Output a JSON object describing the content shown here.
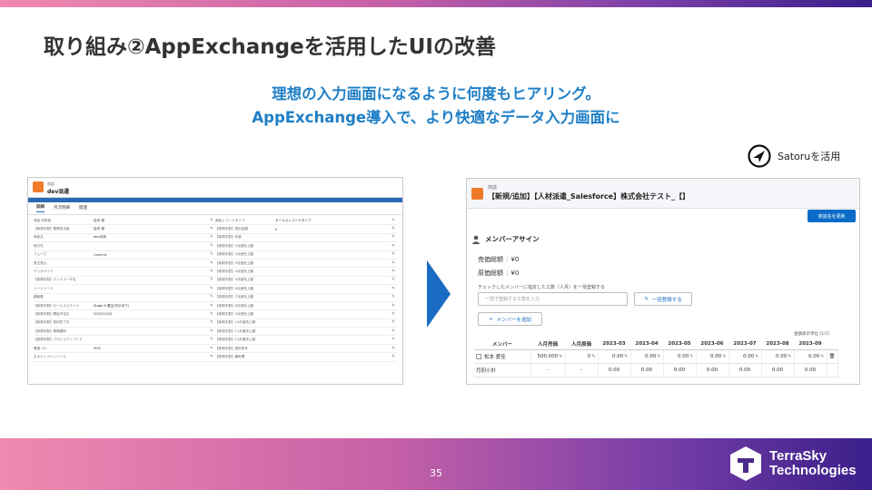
{
  "slide": {
    "title": "取り組み②AppExchangeを活用したUIの改善",
    "subtitle_line1": "理想の入力画面になるように何度もヒアリング。",
    "subtitle_line2": "AppExchange導入で、より快適なデータ入力画面に",
    "satoru_label": "Satoruを活用",
    "page_number": "35",
    "logo_line1": "TerraSky",
    "logo_line2": "Technologies",
    "gradient_colors": [
      "#f08ab0",
      "#c560a8",
      "#7a3fa8",
      "#3a1f8a"
    ],
    "accent_blue": "#1f7fc6",
    "arrow_color": "#1a6bc4"
  },
  "left_screen": {
    "object_label": "商談",
    "record_name": "dev派遣",
    "tabs": [
      "詳細",
      "月次明細",
      "関連"
    ],
    "rows": [
      [
        {
          "label": "商談 所有者",
          "value": "岩本 雅"
        },
        {
          "label": "商談レコードタイプ",
          "value": "セールスレコードタイプ"
        }
      ],
      [
        {
          "label": "【新規手配】業務担当者",
          "value": "岩本 雅"
        },
        {
          "label": "【新規手配】契約金額",
          "value": "0"
        }
      ],
      [
        {
          "label": "商談名",
          "value": "dev派遣"
        },
        {
          "label": "【新規手配】年度",
          "value": ""
        }
      ],
      [
        {
          "label": "取引先",
          "value": ""
        },
        {
          "label": "【新規手配】1月度売上額",
          "value": ""
        }
      ],
      [
        {
          "label": "フェーズ",
          "value": "Commit"
        },
        {
          "label": "【新規手配】2月度売上額",
          "value": ""
        }
      ],
      [
        {
          "label": "受注見込",
          "value": ""
        },
        {
          "label": "【新規手配】3月度売上額",
          "value": ""
        }
      ],
      [
        {
          "label": "デリカバイク",
          "value": ""
        },
        {
          "label": "【新規手配】4月度売上額",
          "value": ""
        }
      ],
      [
        {
          "label": "【新規手配】エンドユーザ名",
          "value": ""
        },
        {
          "label": "【新規手配】5月度売上額",
          "value": ""
        }
      ],
      [
        {
          "label": "リードソース",
          "value": ""
        },
        {
          "label": "【新規手配】6月度売上額",
          "value": ""
        }
      ],
      [
        {
          "label": "顧客層",
          "value": ""
        },
        {
          "label": "【新規手配】7月度売上額",
          "value": ""
        }
      ],
      [
        {
          "label": "【新規手配】セールスステージ",
          "value": "Stage 6 要注(内示あり)"
        },
        {
          "label": "【新規手配】8月度売上額",
          "value": ""
        }
      ],
      [
        {
          "label": "【新規手配】開始予定日",
          "value": "2022/12/01"
        },
        {
          "label": "【新規手配】9月度売上額",
          "value": ""
        }
      ],
      [
        {
          "label": "【新規手配】契約終了日",
          "value": ""
        },
        {
          "label": "【新規手配】10月度売上額",
          "value": ""
        }
      ],
      [
        {
          "label": "【新規手配】稼働種別",
          "value": ""
        },
        {
          "label": "【新規手配】11月度売上額",
          "value": ""
        }
      ],
      [
        {
          "label": "【新規手配】プロジェクトコード",
          "value": ""
        },
        {
          "label": "【新規手配】12月度売上額",
          "value": ""
        }
      ],
      [
        {
          "label": "確度 (%)",
          "value": "90%"
        },
        {
          "label": "【新規手配】契約条件",
          "value": ""
        }
      ],
      [
        {
          "label": "主キャンペーンソース",
          "value": ""
        },
        {
          "label": "【新規手配】備考欄",
          "value": ""
        }
      ]
    ]
  },
  "right_screen": {
    "object_label": "商談",
    "record_title": "【新規/追加】【人材派遣_Salesforce】株式会社テスト_【】",
    "update_button": "商談名を更新",
    "section_title": "メンバーアサイン",
    "sales_total_label": "売価総額",
    "sales_total_value": "¥0",
    "cost_total_label": "原価総額",
    "cost_total_value": "¥0",
    "instruction": "チェックしたメンバーに指定した工数（人月）を一括登録する",
    "bulk_input_placeholder": "一括で登録する工数を入力",
    "bulk_button": "一括登録する",
    "add_member_button": "メンバーを追加",
    "unit_note": "金額表示単位 [1/1]",
    "table": {
      "headers": [
        "メンバー",
        "人月売価",
        "人月原価",
        "2023-03",
        "2023-04",
        "2023-05",
        "2023-06",
        "2023-07",
        "2023-08",
        "2023-09"
      ],
      "rows": [
        {
          "member": "松本 愛佳",
          "unit_price": "500,000",
          "unit_cost": "0",
          "months": [
            "0.00",
            "0.00",
            "0.00",
            "0.00",
            "0.00",
            "0.00",
            "0.00"
          ]
        },
        {
          "member": "月別小計",
          "unit_price": "-",
          "unit_cost": "-",
          "months": [
            "0.00",
            "0.00",
            "0.00",
            "0.00",
            "0.00",
            "0.00",
            "0.00"
          ]
        }
      ]
    }
  }
}
